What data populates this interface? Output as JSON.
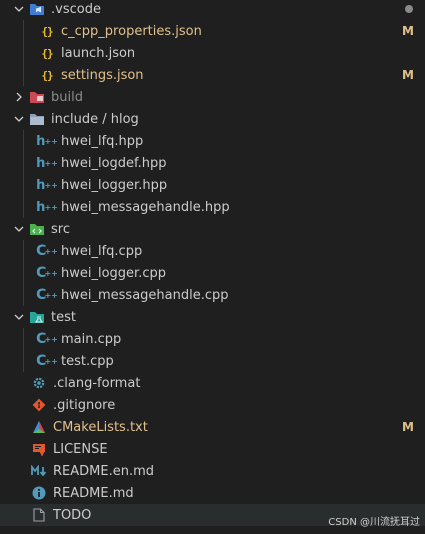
{
  "colors": {
    "background": "#1f1f1f",
    "text": "#cccccc",
    "modified": "#e2c08d",
    "ignored": "#8c8c8c",
    "selected_row": "#2a2d2e"
  },
  "tree": {
    "vscode": {
      "label": ".vscode",
      "icon": "vscode-folder-icon",
      "expanded": true
    },
    "c_cpp_properties": {
      "label": "c_cpp_properties.json",
      "status": "M",
      "icon": "json-icon"
    },
    "launch": {
      "label": "launch.json",
      "icon": "json-icon"
    },
    "settings": {
      "label": "settings.json",
      "status": "M",
      "icon": "json-icon"
    },
    "build": {
      "label": "build",
      "icon": "build-folder-icon",
      "expanded": false
    },
    "include": {
      "label": "include / hlog",
      "icon": "include-folder-icon",
      "expanded": true
    },
    "hwei_lfq_hpp": {
      "label": "hwei_lfq.hpp",
      "icon": "hpp-icon"
    },
    "hwei_logdef_hpp": {
      "label": "hwei_logdef.hpp",
      "icon": "hpp-icon"
    },
    "hwei_logger_hpp": {
      "label": "hwei_logger.hpp",
      "icon": "hpp-icon"
    },
    "hwei_messagehandle_hpp": {
      "label": "hwei_messagehandle.hpp",
      "icon": "hpp-icon"
    },
    "src": {
      "label": "src",
      "icon": "src-folder-icon",
      "expanded": true
    },
    "hwei_lfq_cpp": {
      "label": "hwei_lfq.cpp",
      "icon": "cpp-icon"
    },
    "hwei_logger_cpp": {
      "label": "hwei_logger.cpp",
      "icon": "cpp-icon"
    },
    "hwei_messagehandle_cpp": {
      "label": "hwei_messagehandle.cpp",
      "icon": "cpp-icon"
    },
    "test": {
      "label": "test",
      "icon": "test-folder-icon",
      "expanded": true
    },
    "main_cpp": {
      "label": "main.cpp",
      "icon": "cpp-icon"
    },
    "test_cpp": {
      "label": "test.cpp",
      "icon": "cpp-icon"
    },
    "clang_format": {
      "label": ".clang-format",
      "icon": "gear-icon"
    },
    "gitignore": {
      "label": ".gitignore",
      "icon": "git-icon"
    },
    "cmakelists": {
      "label": "CMakeLists.txt",
      "status": "M",
      "icon": "cmake-icon"
    },
    "license": {
      "label": "LICENSE",
      "icon": "license-icon"
    },
    "readme_en": {
      "label": "README.en.md",
      "icon": "markdown-icon"
    },
    "readme": {
      "label": "README.md",
      "icon": "info-icon"
    },
    "todo": {
      "label": "TODO",
      "icon": "file-icon"
    }
  },
  "watermark": "CSDN @川流抚耳过"
}
